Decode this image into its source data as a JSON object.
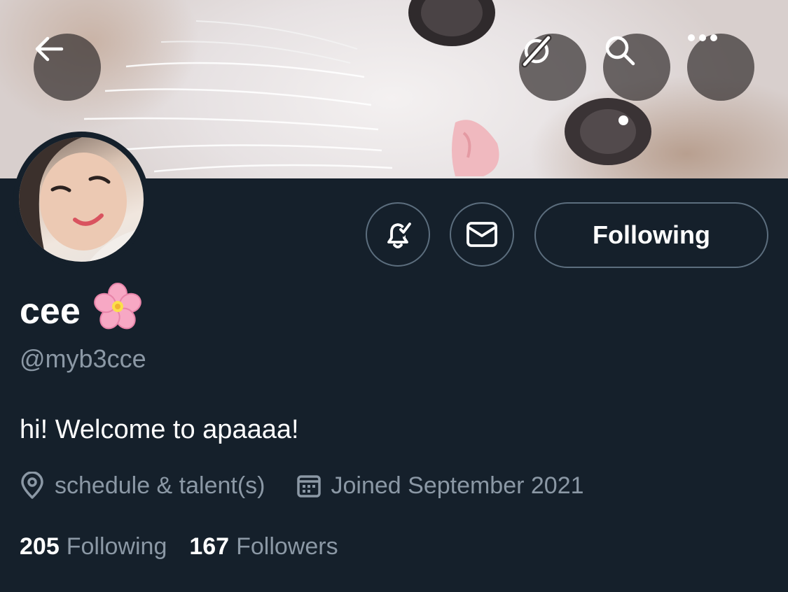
{
  "header": {
    "back_icon": "arrow-left-icon",
    "translate_icon": "slashed-globe-icon",
    "search_icon": "search-icon",
    "more_icon": "more-horizontal-icon"
  },
  "profile": {
    "display_name": "cee",
    "name_emoji": "cherry-blossom",
    "handle": "@myb3cce",
    "bio": "hi! Welcome to apaaaa!",
    "location": "schedule & talent(s)",
    "joined": "Joined September 2021",
    "following_count": "205",
    "following_label": "Following",
    "followers_count": "167",
    "followers_label": "Followers"
  },
  "actions": {
    "notify_icon": "bell-check-icon",
    "message_icon": "envelope-icon",
    "follow_button_label": "Following"
  },
  "colors": {
    "background": "#15202b",
    "secondary_text": "#8b98a5",
    "border": "#5c6e7e"
  }
}
